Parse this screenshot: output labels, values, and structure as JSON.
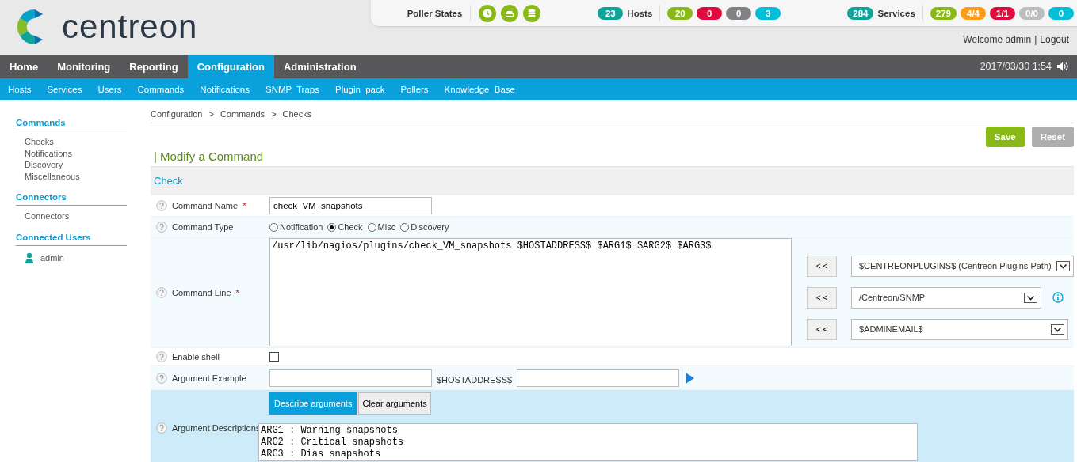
{
  "header": {
    "brand": "centreon",
    "poller_states": {
      "label": "Poller States"
    },
    "hosts": {
      "total": "23",
      "label": "Hosts",
      "color": "#10a39a",
      "badges": [
        {
          "text": "20",
          "color": "#88b917"
        },
        {
          "text": "0",
          "color": "#e00b3d"
        },
        {
          "text": "0",
          "color": "#818285"
        },
        {
          "text": "3",
          "color": "#00bfd6"
        }
      ]
    },
    "services": {
      "total": "284",
      "label": "Services",
      "color": "#10a39a",
      "badges": [
        {
          "text": "279",
          "color": "#88b917"
        },
        {
          "text": "4/4",
          "color": "#ff9a13"
        },
        {
          "text": "1/1",
          "color": "#e00b3d"
        },
        {
          "text": "0/0",
          "color": "#bcbdc0"
        },
        {
          "text": "0",
          "color": "#00bfd6"
        }
      ]
    },
    "welcome": "Welcome admin",
    "separator": "|",
    "logout": "Logout"
  },
  "main_menu": {
    "items": [
      {
        "label": "Home",
        "selected": false
      },
      {
        "label": "Monitoring",
        "selected": false
      },
      {
        "label": "Reporting",
        "selected": false
      },
      {
        "label": "Configuration",
        "selected": true
      },
      {
        "label": "Administration",
        "selected": false
      }
    ],
    "datetime": "2017/03/30 1:54"
  },
  "sub_menu": {
    "items": [
      "Hosts",
      "Services",
      "Users",
      "Commands",
      "Notifications",
      "SNMP Traps",
      "Plugin pack",
      "Pollers",
      "Knowledge Base"
    ]
  },
  "sidebar": {
    "groups": [
      {
        "title": "Commands",
        "kind": "links",
        "items": [
          "Checks",
          "Notifications",
          "Discovery",
          "Miscellaneous"
        ]
      },
      {
        "title": "Connectors",
        "kind": "links",
        "items": [
          "Connectors"
        ]
      },
      {
        "title": "Connected Users",
        "kind": "users",
        "items": [
          "admin"
        ]
      }
    ]
  },
  "breadcrumb": {
    "items": [
      "Configuration",
      "Commands",
      "Checks"
    ],
    "separator": ">"
  },
  "actions": [
    {
      "label": "Save",
      "kind": "primary"
    },
    {
      "label": "Reset",
      "kind": "secondary"
    }
  ],
  "form": {
    "title": "| Modify a Command",
    "section": "Check",
    "rows": [
      {
        "kind": "text",
        "label": "Command Name",
        "required_mark": "*",
        "value": "check_VM_snapshots"
      },
      {
        "kind": "radio",
        "label": "Command Type",
        "options": [
          {
            "label": "Notification",
            "selected": false
          },
          {
            "label": "Check",
            "selected": true
          },
          {
            "label": "Misc",
            "selected": false
          },
          {
            "label": "Discovery",
            "selected": false
          }
        ]
      },
      {
        "kind": "command-line",
        "label": "Command Line",
        "required_mark": "*",
        "value": "/usr/lib/nagios/plugins/check_VM_snapshots $HOSTADDRESS$ $ARG1$ $ARG2$ $ARG3$",
        "macros": [
          {
            "button": "< <",
            "value": "$CENTREONPLUGINS$ (Centreon Plugins Path)",
            "info": false
          },
          {
            "button": "< <",
            "value": "/Centreon/SNMP",
            "info": true
          },
          {
            "button": "< <",
            "value": "$ADMINEMAIL$",
            "info": false
          }
        ]
      },
      {
        "kind": "checkbox",
        "label": "Enable shell",
        "checked": false
      },
      {
        "kind": "argument-example",
        "label": "Argument Example",
        "middle_label": "$HOSTADDRESS$"
      },
      {
        "kind": "argument-descriptions",
        "label": "Argument Descriptions",
        "buttons": [
          "Describe arguments",
          "Clear arguments"
        ],
        "value": "ARG1 : Warning snapshots\nARG2 : Critical snapshots\nARG3 : Dias snapshots"
      }
    ]
  }
}
